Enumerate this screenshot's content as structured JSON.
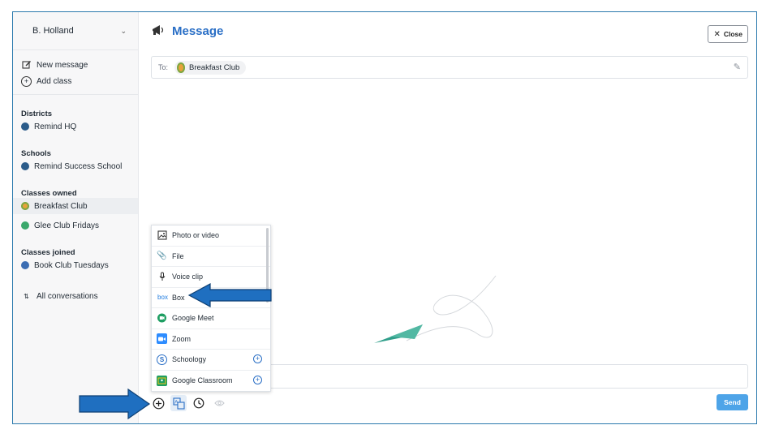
{
  "sidebar": {
    "user": "B. Holland",
    "actions": [
      {
        "label": "New message",
        "icon": "edit-icon"
      },
      {
        "label": "Add class",
        "icon": "plus-circle-icon"
      }
    ],
    "districts_title": "Districts",
    "districts": [
      {
        "label": "Remind HQ",
        "color": "#2b5c8a"
      }
    ],
    "schools_title": "Schools",
    "schools": [
      {
        "label": "Remind Success School",
        "color": "#2b5c8a"
      }
    ],
    "owned_title": "Classes owned",
    "owned": [
      {
        "label": "Breakfast Club",
        "color": "#e8a23a",
        "active": true
      },
      {
        "label": "Glee Club Fridays",
        "color": "#3aa86b"
      }
    ],
    "joined_title": "Classes joined",
    "joined": [
      {
        "label": "Book Club Tuesdays",
        "color": "#3b6db3"
      }
    ],
    "all_conversations": "All conversations"
  },
  "header": {
    "title": "Message",
    "close_label": "Close"
  },
  "to": {
    "label": "To:",
    "recipient": "Breakfast Club"
  },
  "menu": {
    "items": [
      {
        "label": "Photo or video",
        "icon": "photo-icon"
      },
      {
        "label": "File",
        "icon": "paperclip-icon"
      },
      {
        "label": "Voice clip",
        "icon": "microphone-icon"
      },
      {
        "label": "Box",
        "icon": "box-logo-icon",
        "icon_text": "box"
      },
      {
        "label": "Google Meet",
        "icon": "google-meet-icon"
      },
      {
        "label": "Zoom",
        "icon": "zoom-icon"
      },
      {
        "label": "Schoology",
        "icon": "schoology-icon"
      },
      {
        "label": "Google Classroom",
        "icon": "google-classroom-icon"
      }
    ]
  },
  "toolbar": {
    "send_label": "Send"
  },
  "colors": {
    "accent": "#2a6fc6",
    "send": "#4ea4e8",
    "arrow": "#1f6fc0"
  }
}
